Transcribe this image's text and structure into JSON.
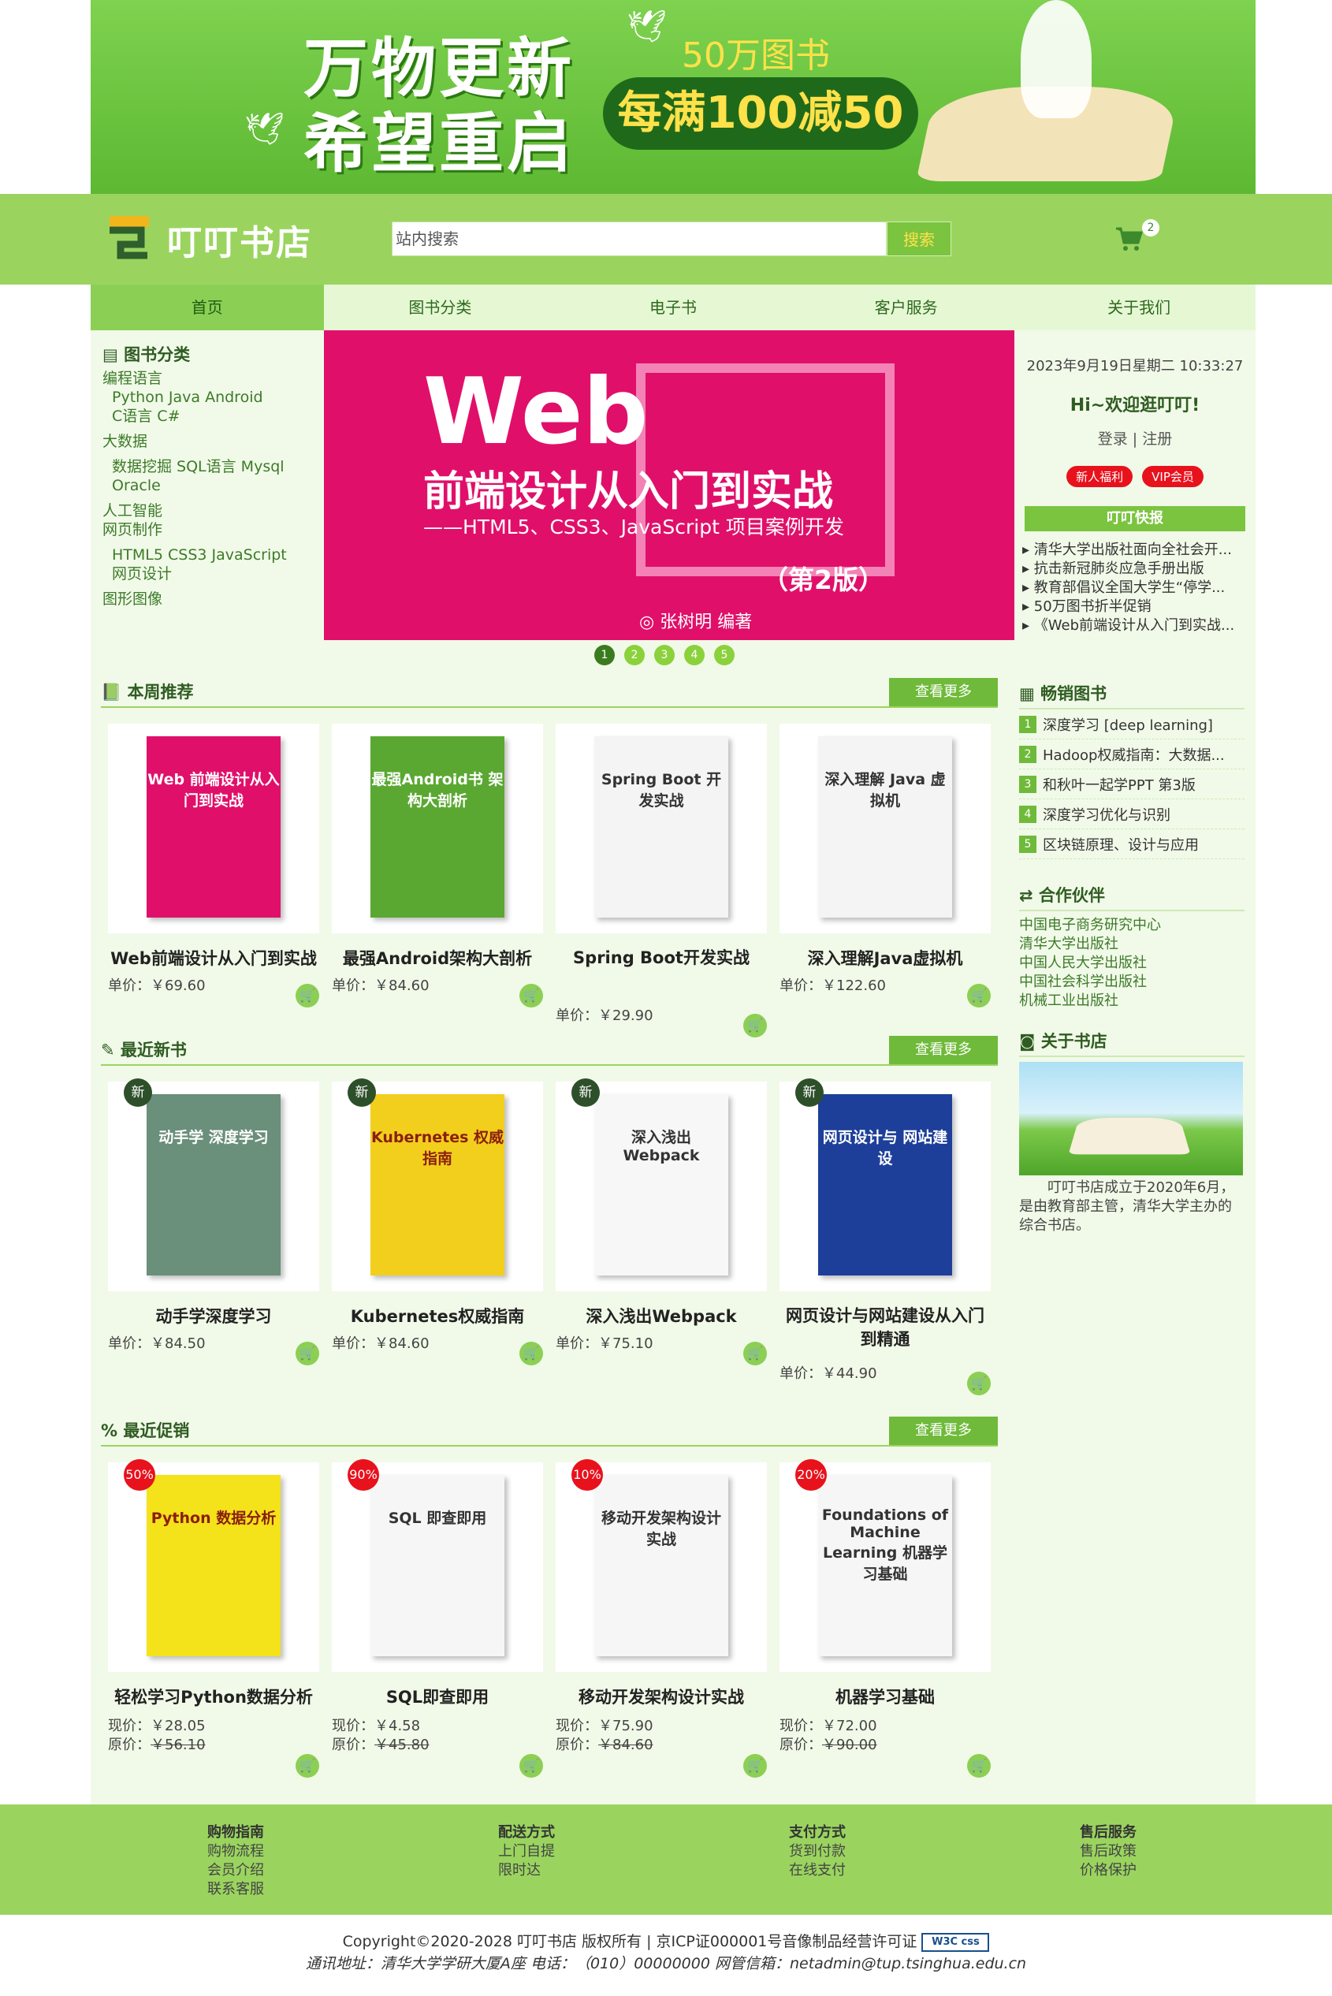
{
  "banner": {
    "line1": "万物更新",
    "line2": "希望重启",
    "books_count": "50万图书",
    "promo": "每满100减50"
  },
  "header": {
    "logo_text": "叮叮书店",
    "search_placeholder": "站内搜索",
    "search_button": "搜索",
    "cart_count": "2"
  },
  "nav": [
    "首页",
    "图书分类",
    "电子书",
    "客户服务",
    "关于我们"
  ],
  "categories": {
    "title": "图书分类",
    "lines": [
      "编程语言",
      "Python Java Android",
      "C语言 C#",
      "大数据",
      "数据挖掘 SQL语言 Mysql",
      "Oracle",
      "人工智能",
      "网页制作",
      "HTML5 CSS3 JavaScript",
      "网页设计",
      "图形图像"
    ]
  },
  "slider": {
    "big": "Web",
    "line1": "前端设计从入门到实战",
    "line2": "——HTML5、CSS3、JavaScript 项目案例开发",
    "edition": "（第2版）",
    "author": "张树明  编著",
    "dots": [
      "1",
      "2",
      "3",
      "4",
      "5"
    ]
  },
  "side_info": {
    "time": "2023年9月19日星期二 10:33:27",
    "greeting": "Hi~欢迎逛叮叮!",
    "login": "登录 | 注册",
    "badge1": "新人福利",
    "badge2": "VIP会员"
  },
  "news": {
    "title": "叮叮快报",
    "items": [
      "清华大学出版社面向全社会开...",
      "抗击新冠肺炎应急手册出版",
      "教育部倡议全国大学生“停学...",
      "50万图书折半促销",
      "《Web前端设计从入门到实战..."
    ]
  },
  "sections": {
    "weekly": "本周推荐",
    "new": "最近新书",
    "promo": "最近促销",
    "more": "查看更多"
  },
  "weekly_books": [
    {
      "title": "Web前端设计从入门到实战",
      "price": "单价：￥69.60",
      "cover": "Web 前端设计从入门到实战",
      "color": "#e0106a"
    },
    {
      "title": "最强Android架构大剖析",
      "price": "单价：￥84.60",
      "cover": "最强Android书 架构大剖析",
      "color": "#5aa832"
    },
    {
      "title": "Spring Boot开发实战",
      "price": "单价：￥29.90",
      "cover": "Spring Boot 开发实战",
      "color": "#f4f4f4"
    },
    {
      "title": "深入理解Java虚拟机",
      "price": "单价：￥122.60",
      "cover": "深入理解 Java 虚拟机",
      "color": "#f4f4f4"
    }
  ],
  "new_books": [
    {
      "title": "动手学深度学习",
      "price": "单价：￥84.50",
      "cover": "动手学 深度学习",
      "color": "#6a8f7a",
      "tag": "新"
    },
    {
      "title": "Kubernetes权威指南",
      "price": "单价：￥84.60",
      "cover": "Kubernetes 权威指南",
      "color": "#f2cf1c",
      "tag": "新"
    },
    {
      "title": "深入浅出Webpack",
      "price": "单价：￥75.10",
      "cover": "深入浅出 Webpack",
      "color": "#f7f7f7",
      "tag": "新"
    },
    {
      "title": "网页设计与网站建设从入门到精通",
      "price": "单价：￥44.90",
      "cover": "网页设计与 网站建设",
      "color": "#1d3f9a",
      "tag": "新"
    }
  ],
  "promo_books": [
    {
      "title": "轻松学习Python数据分析",
      "now": "现价：￥28.05",
      "orig_label": "原价：",
      "orig": "￥56.10",
      "cover": "Python 数据分析",
      "color": "#f4e21a",
      "tag": "50%"
    },
    {
      "title": "SQL即查即用",
      "now": "现价：￥4.58",
      "orig_label": "原价：",
      "orig": "￥45.80",
      "cover": "SQL 即查即用",
      "color": "#f6f6f6",
      "tag": "90%"
    },
    {
      "title": "移动开发架构设计实战",
      "now": "现价：￥75.90",
      "orig_label": "原价：",
      "orig": "￥84.60",
      "cover": "移动开发架构设计实战",
      "color": "#f6f6f6",
      "tag": "10%"
    },
    {
      "title": "机器学习基础",
      "now": "现价：￥72.00",
      "orig_label": "原价：",
      "orig": "￥90.00",
      "cover": "Foundations of Machine Learning 机器学习基础",
      "color": "#f6f6f6",
      "tag": "20%"
    }
  ],
  "bestsellers": {
    "title": "畅销图书",
    "items": [
      "深度学习 [deep learning]",
      "Hadoop权威指南：大数据...",
      "和秋叶一起学PPT 第3版",
      "深度学习优化与识别",
      "区块链原理、设计与应用"
    ]
  },
  "partners": {
    "title": "合作伙伴",
    "items": [
      "中国电子商务研究中心",
      "清华大学出版社",
      "中国人民大学出版社",
      "中国社会科学出版社",
      "机械工业出版社"
    ]
  },
  "about": {
    "title": "关于书店",
    "text": "叮叮书店成立于2020年6月，是由教育部主管，清华大学主办的综合书店。"
  },
  "footer": {
    "cols": [
      {
        "head": "购物指南",
        "items": [
          "购物流程",
          "会员介绍",
          "联系客服"
        ]
      },
      {
        "head": "配送方式",
        "items": [
          "上门自提",
          "限时达"
        ]
      },
      {
        "head": "支付方式",
        "items": [
          "货到付款",
          "在线支付"
        ]
      },
      {
        "head": "售后服务",
        "items": [
          "售后政策",
          "价格保护"
        ]
      }
    ],
    "copyright": "Copyright©2020-2028 叮叮书店 版权所有 | 京ICP证000001号音像制品经营许可证",
    "w3c": "W3C css",
    "address": "通讯地址：清华大学学研大厦A座  电话：（010）00000000  网管信箱：netadmin@tup.tsinghua.edu.cn"
  }
}
